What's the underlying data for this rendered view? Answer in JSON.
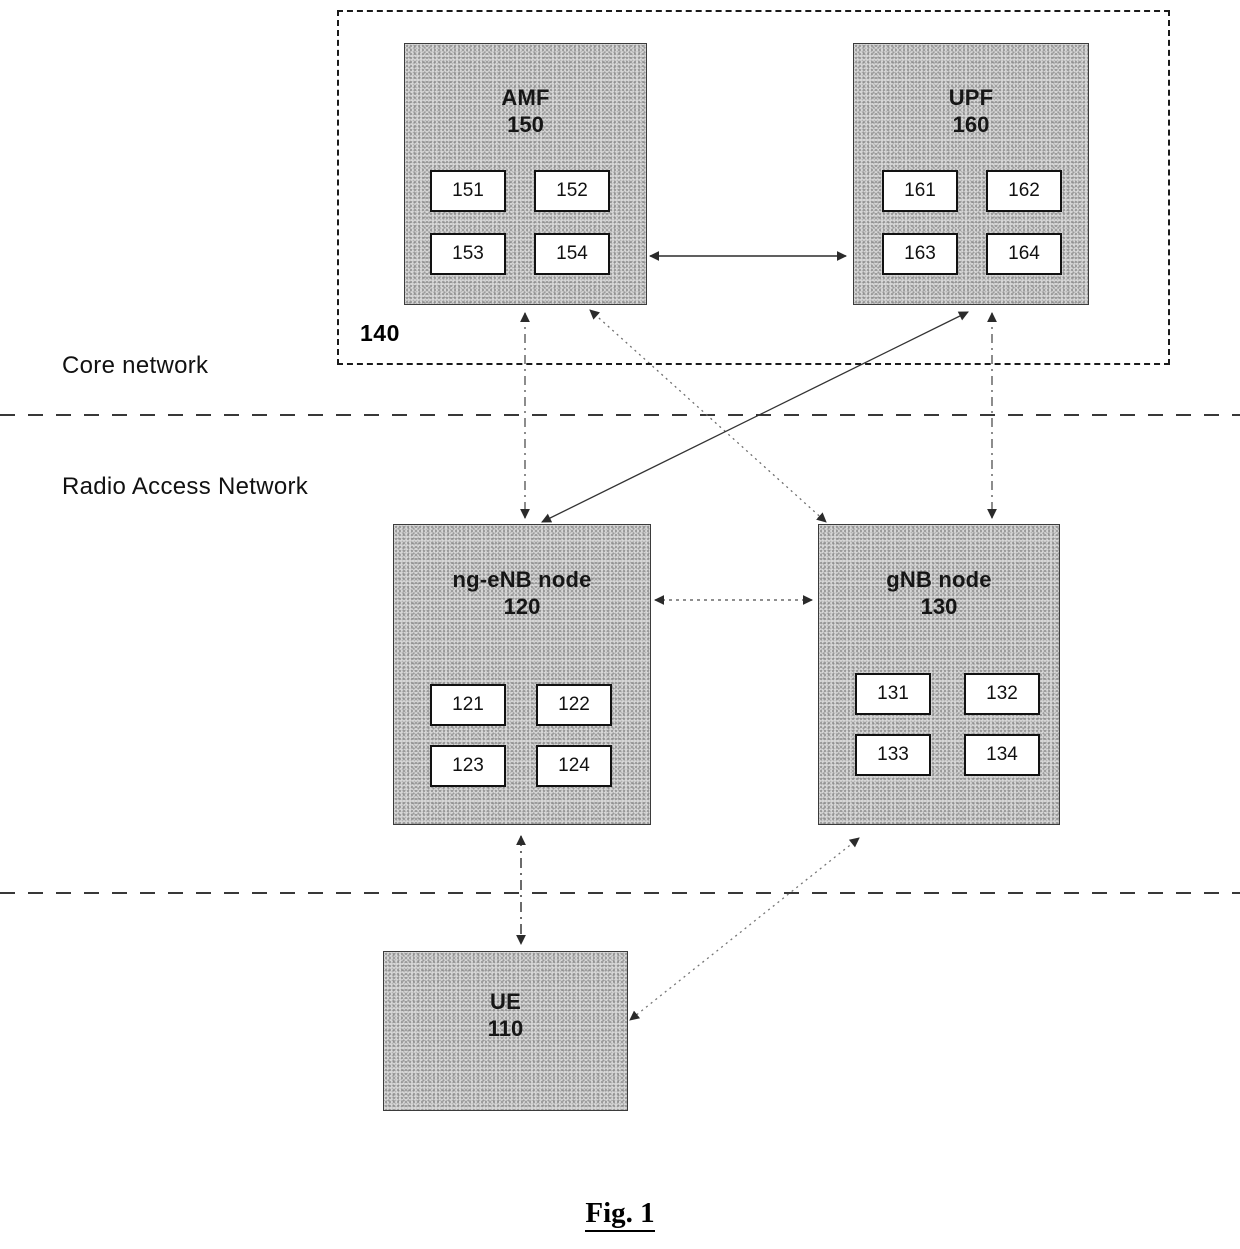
{
  "figure": {
    "caption": "Fig. 1"
  },
  "regions": [
    {
      "id": "core-network",
      "label": "Core network"
    },
    {
      "id": "radio-access-network",
      "label": "Radio Access Network"
    }
  ],
  "enclosure": {
    "name": "core-network-boundary",
    "ref": "140"
  },
  "nodes": [
    {
      "id": "amf",
      "title": "AMF",
      "ref": "150",
      "subboxes": [
        "151",
        "152",
        "153",
        "154"
      ]
    },
    {
      "id": "upf",
      "title": "UPF",
      "ref": "160",
      "subboxes": [
        "161",
        "162",
        "163",
        "164"
      ]
    },
    {
      "id": "ng-enb",
      "title": "ng-eNB node",
      "ref": "120",
      "subboxes": [
        "121",
        "122",
        "123",
        "124"
      ]
    },
    {
      "id": "gnb",
      "title": "gNB node",
      "ref": "130",
      "subboxes": [
        "131",
        "132",
        "133",
        "134"
      ]
    },
    {
      "id": "ue",
      "title": "UE",
      "ref": "110",
      "subboxes": []
    }
  ],
  "connections": [
    {
      "id": "amf-upf",
      "from": "amf",
      "to": "upf",
      "style": "solid",
      "arrows": "both"
    },
    {
      "id": "ngenb-gnb",
      "from": "ng-enb",
      "to": "gnb",
      "style": "dotted",
      "arrows": "both"
    },
    {
      "id": "amf-ngenb",
      "from": "amf",
      "to": "ng-enb",
      "style": "dashdot",
      "arrows": "both"
    },
    {
      "id": "upf-gnb",
      "from": "upf",
      "to": "gnb",
      "style": "dashdot",
      "arrows": "both"
    },
    {
      "id": "amf-gnb",
      "from": "amf",
      "to": "gnb",
      "style": "dotted",
      "arrows": "both"
    },
    {
      "id": "upf-ngenb",
      "from": "upf",
      "to": "ng-enb",
      "style": "solid",
      "arrows": "both"
    },
    {
      "id": "ue-ngenb",
      "from": "ue",
      "to": "ng-enb",
      "style": "dashdot",
      "arrows": "both"
    },
    {
      "id": "ue-gnb",
      "from": "ue",
      "to": "gnb",
      "style": "dotted",
      "arrows": "both"
    }
  ],
  "separators": [
    {
      "id": "core-ran-divider"
    },
    {
      "id": "ran-ue-divider"
    }
  ],
  "colors": {
    "ink": "#000000",
    "block_fill": "#d6d6d6",
    "block_border": "#3b3b3b",
    "subbox_border": "#121212"
  }
}
